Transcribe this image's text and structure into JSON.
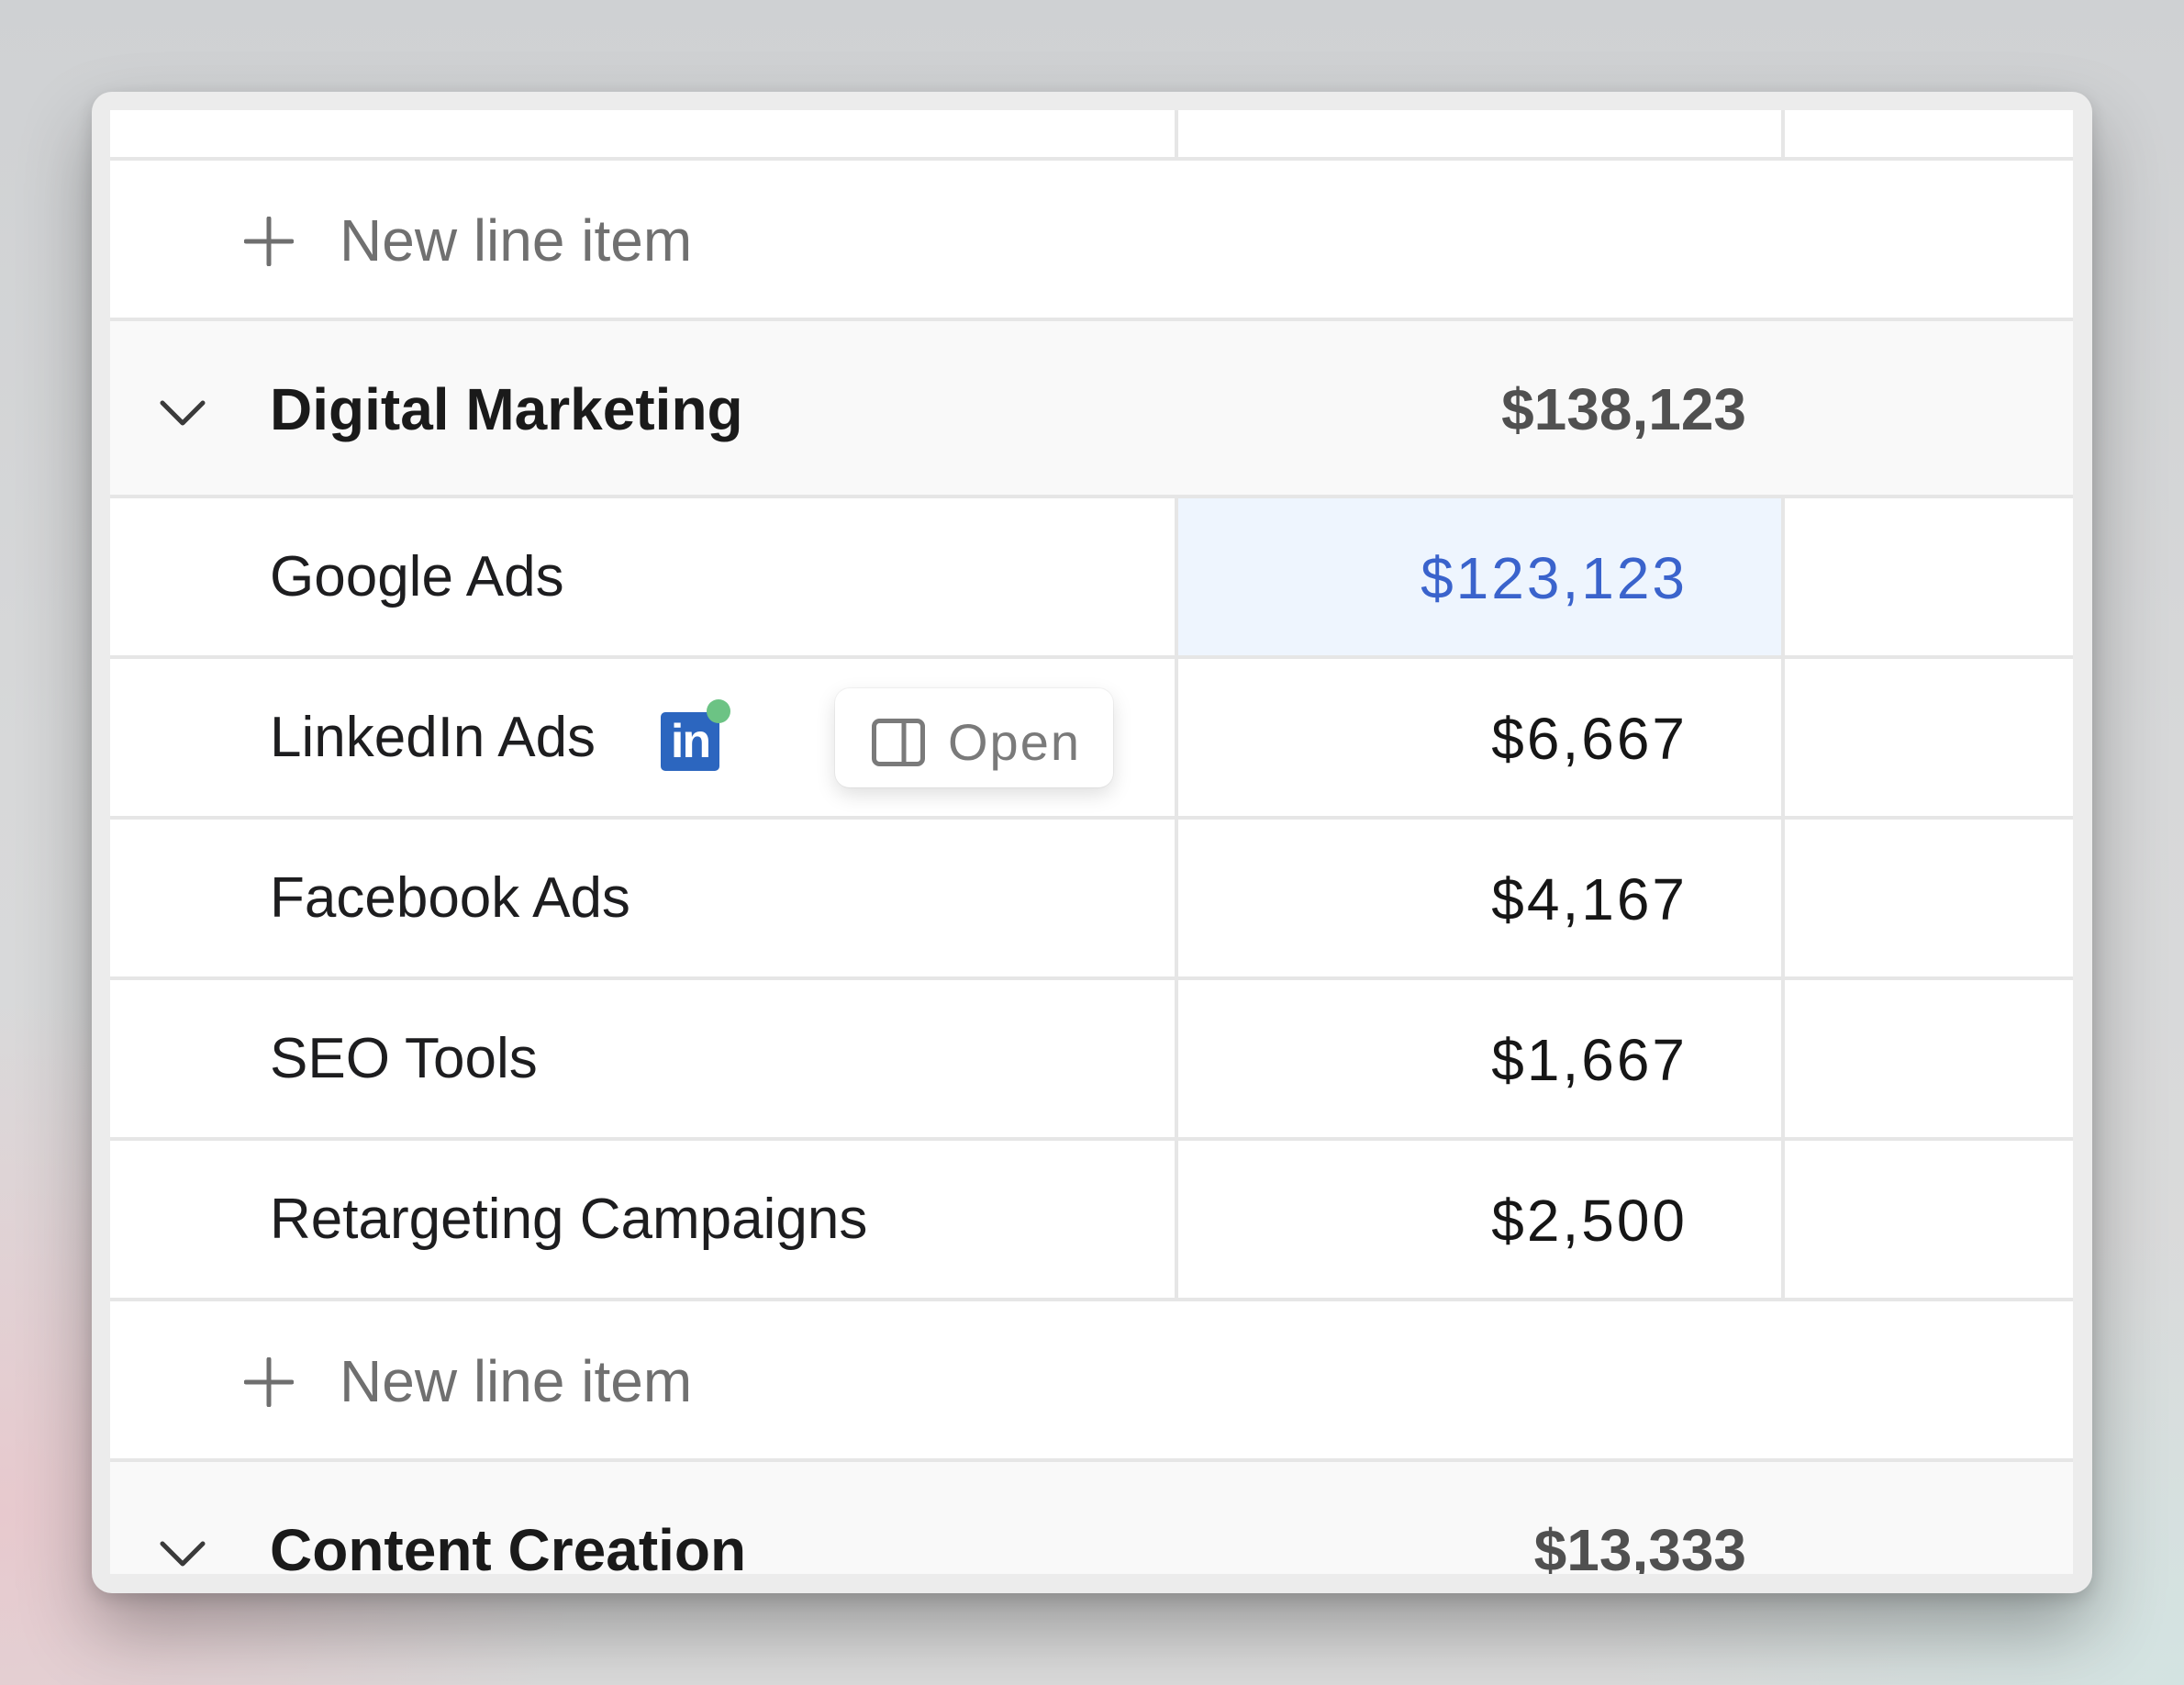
{
  "top_new_line_item": {
    "label": "New line item"
  },
  "groups": [
    {
      "name": "Digital Marketing",
      "total": "$138,123",
      "items": [
        {
          "name": "Google Ads",
          "amount": "$123,123",
          "selected": true
        },
        {
          "name": "LinkedIn Ads",
          "amount": "$6,667",
          "icon": "linkedin-icon",
          "icon_text": "in",
          "status_dot_color": "#6cc384"
        },
        {
          "name": "Facebook Ads",
          "amount": "$4,167"
        },
        {
          "name": "SEO Tools",
          "amount": "$1,667"
        },
        {
          "name": "Retargeting Campaigns",
          "amount": "$2,500"
        }
      ],
      "new_line_item_label": "New line item"
    },
    {
      "name": "Content Creation",
      "total": "$13,333"
    }
  ],
  "open_button": {
    "label": "Open",
    "icon": "side-panel-icon"
  },
  "colors": {
    "selected_cell_bg": "#eef5fe",
    "selected_value": "#3a63cc",
    "linkedin_brand": "#2c66bf",
    "grid_line": "#e6e6e6",
    "group_row_bg": "#f9f9f9"
  }
}
